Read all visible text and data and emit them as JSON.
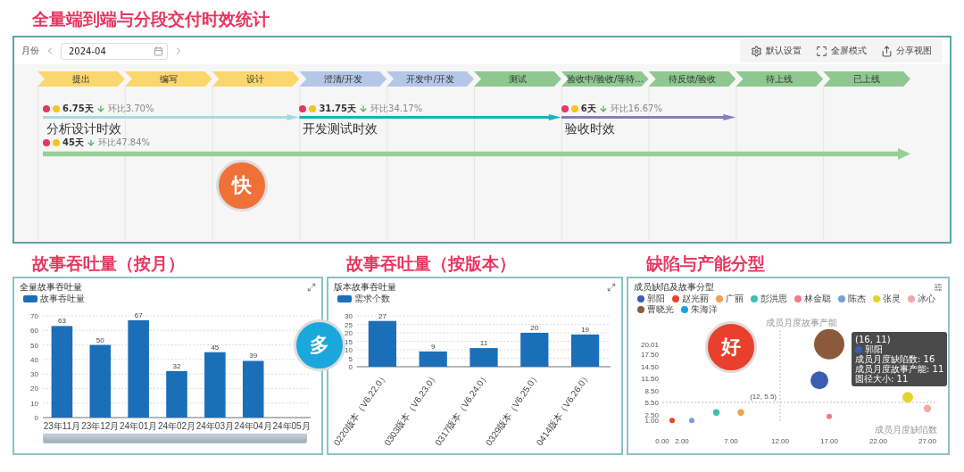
{
  "page_title": "全量端到端与分段交付时效统计",
  "top_panel": {
    "toolbar": {
      "month_label": "月份",
      "date_value": "2024-04",
      "actions": [
        {
          "kind": "settings",
          "label": "默认设置"
        },
        {
          "kind": "fullscreen",
          "label": "全屏模式"
        },
        {
          "kind": "share",
          "label": "分享视图"
        }
      ]
    },
    "stages": [
      {
        "label": "提出",
        "color": "#f9d76c"
      },
      {
        "label": "编写",
        "color": "#f9d76c"
      },
      {
        "label": "设计",
        "color": "#f9d76c"
      },
      {
        "label": "澄清/开发",
        "color": "#b4c7e7"
      },
      {
        "label": "开发中/开发",
        "color": "#b4c7e7"
      },
      {
        "label": "测试",
        "color": "#8ec890"
      },
      {
        "label": "验收中/验收/等待...",
        "color": "#8ec890"
      },
      {
        "label": "待反馈/验收",
        "color": "#8ec890"
      },
      {
        "label": "待上线",
        "color": "#8ec890"
      },
      {
        "label": "已上线",
        "color": "#8ec890"
      }
    ],
    "flows": [
      {
        "days": "6.75天",
        "change": "环比3.70%",
        "label": "分析设计时效",
        "color": "#a6dae0"
      },
      {
        "days": "31.75天",
        "change": "环比34.17%",
        "label": "开发测试时效",
        "color": "#14b4bc"
      },
      {
        "days": "6天",
        "change": "环比16.67%",
        "label": "验收时效",
        "color": "#8a7cc0"
      },
      {
        "days": "45天",
        "change": "环比47.84%",
        "color": "#98cf98"
      }
    ],
    "badge": "快"
  },
  "charts": [
    {
      "kind": "bar",
      "heading": "故事吞吐量（按月）",
      "title": "全量故事吞吐量",
      "badge": "多",
      "zoom_slider": {
        "level": 1
      },
      "chart_data": {
        "type": "bar",
        "categories": [
          "23年11月",
          "23年12月",
          "24年01月",
          "24年02月",
          "24年03月",
          "24年04月",
          "24年05月"
        ],
        "series": [
          {
            "name": "故事吞吐量",
            "color": "#1b6fb8",
            "values": [
              63,
              50,
              67,
              32,
              45,
              39,
              null
            ]
          }
        ],
        "ylim": [
          0,
          70
        ],
        "yticks": [
          0,
          10,
          20,
          30,
          40,
          50,
          60,
          70
        ],
        "grid": true,
        "data_labels": true
      }
    },
    {
      "kind": "bar",
      "heading": "故事吞吐量（按版本）",
      "title": "版本故事吞吐量",
      "chart_data": {
        "type": "bar",
        "categories": [
          "0220版本（V6.22.0）",
          "0303版本（V6.23.0）",
          "0317版本（V6.24.0）",
          "0329版本（V6.25.0）",
          "0414版本（V6.26.0）"
        ],
        "series": [
          {
            "name": "需求个数",
            "color": "#1b6fb8",
            "values": [
              27,
              9,
              11,
              20,
              19
            ]
          }
        ],
        "ylim": [
          0,
          30
        ],
        "yticks": [
          0,
          5,
          10,
          15,
          20,
          25,
          30
        ],
        "grid": true,
        "data_labels": true
      }
    },
    {
      "kind": "scatter",
      "heading": "缺陷与产能分型",
      "title": "成员缺陷及故事分型",
      "badge": "好",
      "tooltip": {
        "title": "(16, 11)",
        "series": "郭阳",
        "lines": [
          "成员月度缺陷数: 16",
          "成员月度故事产能: 11",
          "圆径大小: 11"
        ]
      },
      "chart_data": {
        "type": "scatter",
        "xlabel": "成员月度缺陷数",
        "ylabel": "成员月度故事产能",
        "xlim": [
          0,
          28
        ],
        "ylim": [
          0.4,
          23.5
        ],
        "x": [
          1,
          3,
          5.5,
          8,
          16,
          17,
          25,
          27
        ],
        "xticks": [
          {
            "value": 0,
            "label": "0.00"
          },
          {
            "value": 2,
            "label": "2.00"
          },
          {
            "value": 7,
            "label": "7.00"
          },
          {
            "value": 12,
            "label": "12.00"
          },
          {
            "value": 17,
            "label": "17.00"
          },
          {
            "value": 22,
            "label": "22.00"
          },
          {
            "value": 27,
            "label": "27.00"
          }
        ],
        "yticks": [
          {
            "value": 1,
            "label": "1.00"
          },
          {
            "value": 2.5,
            "label": "2.50"
          },
          {
            "value": 5.5,
            "label": "5.50"
          },
          {
            "value": 8.5,
            "label": "8.50"
          },
          {
            "value": 11.5,
            "label": "11.50"
          },
          {
            "value": 14.5,
            "label": "14.50"
          },
          {
            "value": 17.5,
            "label": "17.50"
          },
          {
            "value": 20.01,
            "label": "20.01"
          }
        ],
        "series": [
          {
            "name": "郭阳",
            "color": "#3a5eb0",
            "values": [
              null,
              null,
              null,
              null,
              11,
              null,
              null,
              null
            ]
          },
          {
            "name": "赵光丽",
            "color": "#e8432f",
            "values": [
              1,
              null,
              null,
              null,
              null,
              null,
              null,
              null
            ]
          },
          {
            "name": "广丽",
            "color": "#f0a050",
            "values": [
              null,
              null,
              null,
              3,
              null,
              null,
              null,
              null
            ]
          },
          {
            "name": "彭洪思",
            "color": "#3bbfb8",
            "values": [
              null,
              null,
              3,
              null,
              null,
              null,
              null,
              null
            ]
          },
          {
            "name": "林金聪",
            "color": "#ef7a8c",
            "values": [
              null,
              null,
              null,
              null,
              null,
              2,
              null,
              null
            ]
          },
          {
            "name": "陈杰",
            "color": "#7a9fd6",
            "values": [
              null,
              1,
              null,
              null,
              null,
              null,
              null,
              null
            ]
          },
          {
            "name": "张灵",
            "color": "#e3d42e",
            "values": [
              null,
              null,
              null,
              null,
              null,
              null,
              6.8,
              null
            ]
          },
          {
            "name": "冰心",
            "color": "#f4a8a8",
            "values": [
              null,
              null,
              null,
              null,
              null,
              null,
              null,
              4
            ]
          },
          {
            "name": "曹晓光",
            "color": "#8b5a3c",
            "values": [
              null,
              null,
              null,
              null,
              null,
              20,
              null,
              null
            ]
          },
          {
            "name": "朱海洋",
            "color": "#1aa3dd",
            "values": [
              null,
              null,
              null,
              null,
              null,
              null,
              null,
              null
            ]
          }
        ],
        "annotations": [
          {
            "text": "(12, 5.5)"
          }
        ]
      }
    }
  ]
}
